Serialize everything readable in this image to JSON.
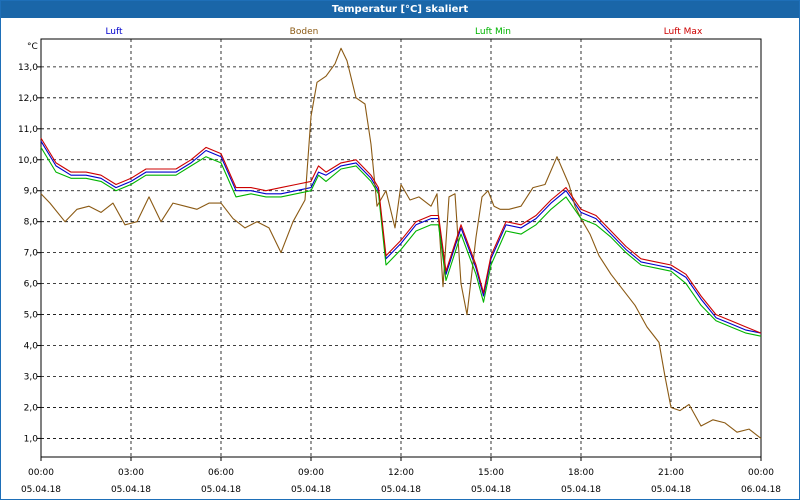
{
  "window": {
    "title": "Temperatur [°C] skaliert"
  },
  "chart_data": {
    "type": "line",
    "title": "Temperatur [°C] skaliert",
    "ylabel": "°C",
    "xlabel": "",
    "ylim": [
      0.4,
      13.9
    ],
    "xlim": [
      0,
      24
    ],
    "grid": true,
    "legend_position": "top",
    "y_ticks": [
      "1,0",
      "2,0",
      "3,0",
      "4,0",
      "5,0",
      "6,0",
      "7,0",
      "8,0",
      "9,0",
      "10,0",
      "11,0",
      "12,0",
      "13,0"
    ],
    "y_tick_values": [
      1,
      2,
      3,
      4,
      5,
      6,
      7,
      8,
      9,
      10,
      11,
      12,
      13
    ],
    "x_ticks": [
      {
        "x": 0,
        "time": "00:00",
        "date": "05.04.18"
      },
      {
        "x": 3,
        "time": "03:00",
        "date": "05.04.18"
      },
      {
        "x": 6,
        "time": "06:00",
        "date": "05.04.18"
      },
      {
        "x": 9,
        "time": "09:00",
        "date": "05.04.18"
      },
      {
        "x": 12,
        "time": "12:00",
        "date": "05.04.18"
      },
      {
        "x": 15,
        "time": "15:00",
        "date": "05.04.18"
      },
      {
        "x": 18,
        "time": "18:00",
        "date": "05.04.18"
      },
      {
        "x": 21,
        "time": "21:00",
        "date": "05.04.18"
      },
      {
        "x": 24,
        "time": "00:00",
        "date": "06.04.18"
      }
    ],
    "series": [
      {
        "name": "Luft",
        "color": "#0000cc",
        "x": [
          0,
          0.5,
          1,
          1.5,
          2,
          2.5,
          3,
          3.5,
          4,
          4.5,
          5,
          5.5,
          6,
          6.5,
          7,
          7.5,
          8,
          8.5,
          9,
          9.25,
          9.5,
          10,
          10.5,
          11,
          11.25,
          11.5,
          12,
          12.5,
          13,
          13.25,
          13.5,
          14,
          14.5,
          14.75,
          15,
          15.5,
          16,
          16.5,
          17,
          17.5,
          18,
          18.5,
          19,
          19.5,
          20,
          20.5,
          21,
          21.5,
          22,
          22.5,
          23,
          23.5,
          24
        ],
        "y": [
          10.6,
          9.8,
          9.5,
          9.5,
          9.4,
          9.1,
          9.3,
          9.6,
          9.6,
          9.6,
          9.9,
          10.3,
          10.1,
          9.0,
          9.0,
          8.9,
          8.9,
          9.0,
          9.1,
          9.6,
          9.5,
          9.8,
          9.9,
          9.4,
          9.0,
          6.8,
          7.3,
          7.9,
          8.1,
          8.1,
          6.3,
          7.8,
          6.5,
          5.6,
          6.8,
          7.9,
          7.8,
          8.1,
          8.6,
          9.0,
          8.3,
          8.1,
          7.6,
          7.1,
          6.7,
          6.6,
          6.5,
          6.2,
          5.5,
          4.9,
          4.7,
          4.5,
          4.4
        ]
      },
      {
        "name": "Boden",
        "color": "#8b5a14",
        "x": [
          0,
          0.3,
          0.8,
          1.2,
          1.6,
          2,
          2.4,
          2.8,
          3.2,
          3.6,
          4,
          4.4,
          4.8,
          5.2,
          5.6,
          6,
          6.4,
          6.8,
          7.2,
          7.6,
          8,
          8.4,
          8.8,
          9,
          9.2,
          9.5,
          9.8,
          10,
          10.2,
          10.5,
          10.8,
          11,
          11.2,
          11.5,
          11.8,
          12,
          12.3,
          12.6,
          13,
          13.2,
          13.4,
          13.6,
          13.8,
          14,
          14.2,
          14.5,
          14.7,
          14.9,
          15.1,
          15.3,
          15.6,
          16,
          16.4,
          16.8,
          17.2,
          17.6,
          17.8,
          18,
          18.3,
          18.6,
          19,
          19.4,
          19.8,
          20.2,
          20.6,
          20.8,
          21,
          21.3,
          21.6,
          22,
          22.4,
          22.8,
          23.2,
          23.6,
          24
        ],
        "y": [
          8.9,
          8.6,
          8.0,
          8.4,
          8.5,
          8.3,
          8.6,
          7.9,
          8.0,
          8.8,
          8.0,
          8.6,
          8.5,
          8.4,
          8.6,
          8.6,
          8.1,
          7.8,
          8.0,
          7.8,
          7.0,
          8.0,
          8.7,
          11.4,
          12.5,
          12.7,
          13.1,
          13.6,
          13.2,
          12.0,
          11.8,
          10.5,
          8.5,
          9.0,
          7.8,
          9.2,
          8.7,
          8.8,
          8.5,
          8.9,
          5.9,
          8.8,
          8.9,
          6.0,
          5.0,
          7.5,
          8.8,
          9.0,
          8.5,
          8.4,
          8.4,
          8.5,
          9.1,
          9.2,
          10.1,
          9.2,
          8.5,
          8.1,
          7.6,
          6.9,
          6.3,
          5.8,
          5.3,
          4.6,
          4.1,
          3.0,
          2.0,
          1.9,
          2.1,
          1.4,
          1.6,
          1.5,
          1.2,
          1.3,
          1.0
        ]
      },
      {
        "name": "Luft Min",
        "color": "#00b400",
        "x": [
          0,
          0.5,
          1,
          1.5,
          2,
          2.5,
          3,
          3.5,
          4,
          4.5,
          5,
          5.5,
          6,
          6.5,
          7,
          7.5,
          8,
          8.5,
          9,
          9.25,
          9.5,
          10,
          10.5,
          11,
          11.25,
          11.5,
          12,
          12.5,
          13,
          13.25,
          13.5,
          14,
          14.5,
          14.75,
          15,
          15.5,
          16,
          16.5,
          17,
          17.5,
          18,
          18.5,
          19,
          19.5,
          20,
          20.5,
          21,
          21.5,
          22,
          22.5,
          23,
          23.5,
          24
        ],
        "y": [
          10.4,
          9.6,
          9.4,
          9.4,
          9.3,
          9.0,
          9.2,
          9.5,
          9.5,
          9.5,
          9.8,
          10.1,
          9.9,
          8.8,
          8.9,
          8.8,
          8.8,
          8.9,
          9.0,
          9.5,
          9.3,
          9.7,
          9.8,
          9.3,
          8.9,
          6.6,
          7.1,
          7.7,
          7.9,
          7.9,
          6.1,
          7.6,
          6.3,
          5.4,
          6.6,
          7.7,
          7.6,
          7.9,
          8.4,
          8.8,
          8.1,
          7.9,
          7.5,
          7.0,
          6.6,
          6.5,
          6.4,
          6.0,
          5.3,
          4.8,
          4.6,
          4.4,
          4.3
        ]
      },
      {
        "name": "Luft Max",
        "color": "#cc0000",
        "x": [
          0,
          0.5,
          1,
          1.5,
          2,
          2.5,
          3,
          3.5,
          4,
          4.5,
          5,
          5.5,
          6,
          6.5,
          7,
          7.5,
          8,
          8.5,
          9,
          9.25,
          9.5,
          10,
          10.5,
          11,
          11.25,
          11.5,
          12,
          12.5,
          13,
          13.25,
          13.5,
          14,
          14.5,
          14.75,
          15,
          15.5,
          16,
          16.5,
          17,
          17.5,
          18,
          18.5,
          19,
          19.5,
          20,
          20.5,
          21,
          21.5,
          22,
          22.5,
          23,
          23.5,
          24
        ],
        "y": [
          10.7,
          9.9,
          9.6,
          9.6,
          9.5,
          9.2,
          9.4,
          9.7,
          9.7,
          9.7,
          10.0,
          10.4,
          10.2,
          9.1,
          9.1,
          9.0,
          9.1,
          9.2,
          9.3,
          9.8,
          9.6,
          9.9,
          10.0,
          9.5,
          9.1,
          6.9,
          7.4,
          8.0,
          8.2,
          8.2,
          6.4,
          7.9,
          6.6,
          5.7,
          6.9,
          8.0,
          7.9,
          8.2,
          8.7,
          9.1,
          8.4,
          8.2,
          7.7,
          7.2,
          6.8,
          6.7,
          6.6,
          6.3,
          5.6,
          5.0,
          4.8,
          4.6,
          4.4
        ]
      }
    ]
  }
}
